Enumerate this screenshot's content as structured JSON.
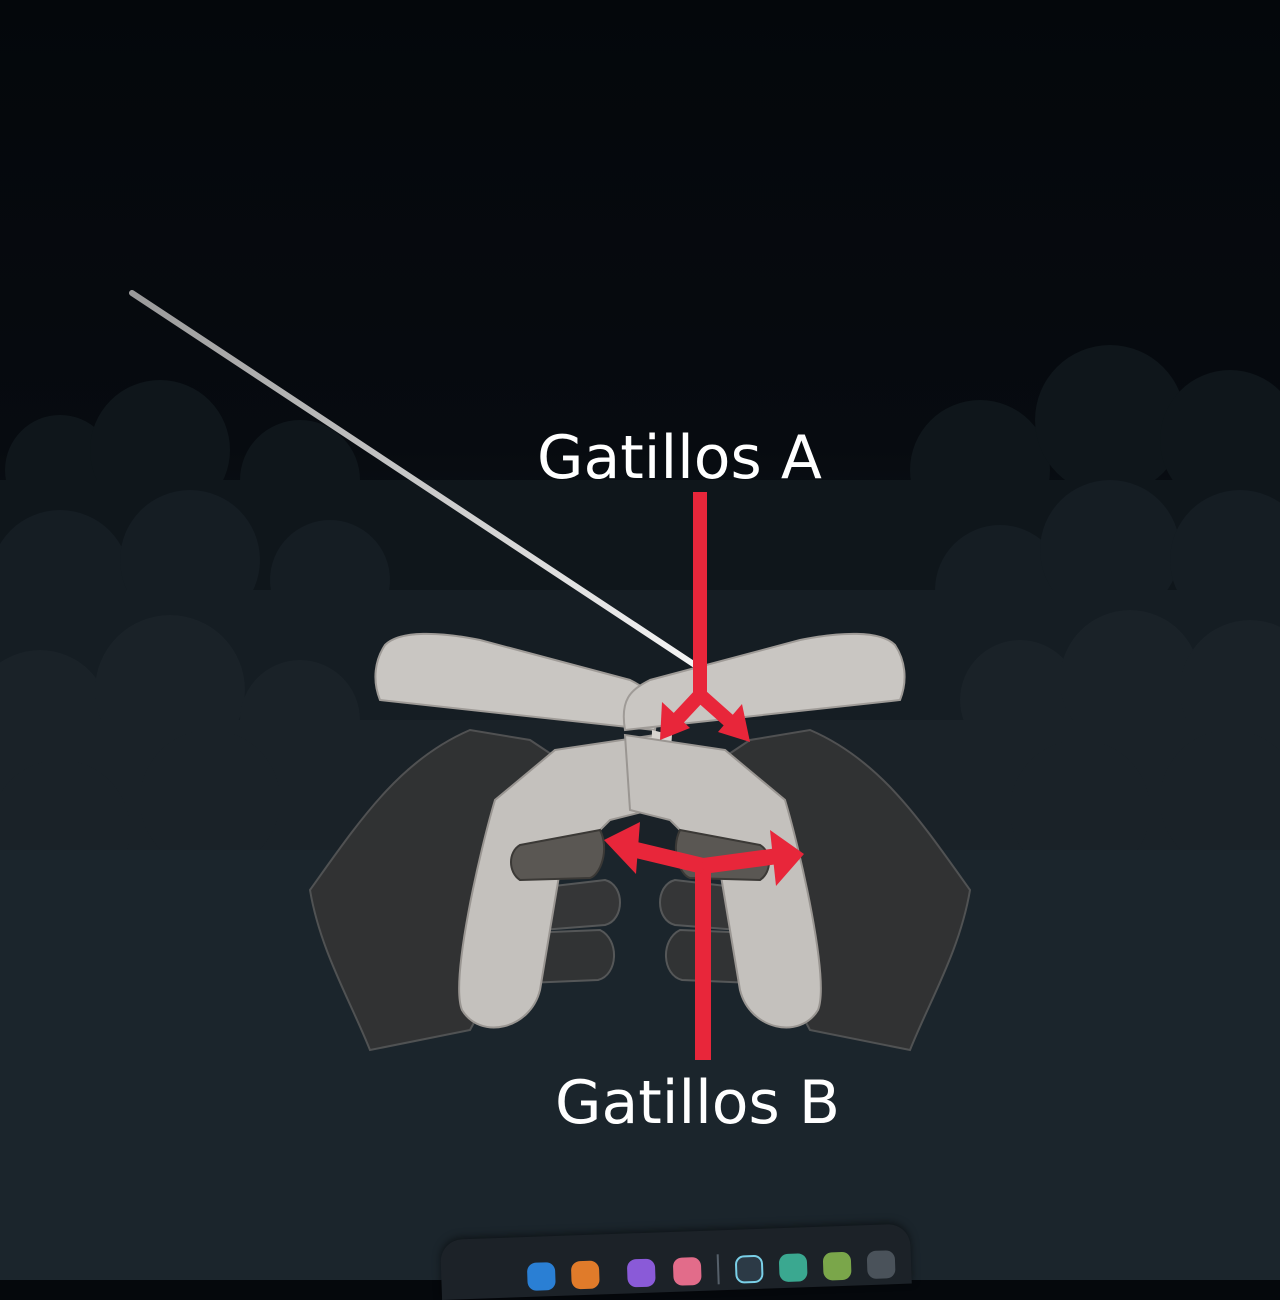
{
  "annotations": {
    "trigger_a_label": "Gatillos A",
    "trigger_b_label": "Gatillos B"
  },
  "colors": {
    "sky_top": "#05080c",
    "sky_bottom": "#1c252c",
    "cloud": "#1a2228",
    "controller": "#c9c6c2",
    "hand": "#3a3a3a",
    "arrow": "#e8263a",
    "laser": "#e8e8e8",
    "label": "#ffffff"
  },
  "taskbar": {
    "apps": [
      {
        "icon": "app-blue-icon",
        "color": "#2a7fd4"
      },
      {
        "icon": "app-orange-icon",
        "color": "#e07b2a"
      },
      {
        "icon": "app-purple-icon",
        "color": "#8a5ad8"
      },
      {
        "icon": "app-pink-icon",
        "color": "#e26c8a"
      },
      {
        "icon": "settings-icon",
        "color": "#2c3a46"
      },
      {
        "icon": "home-icon",
        "color": "#3aa890"
      },
      {
        "icon": "store-icon",
        "color": "#7aa64a"
      },
      {
        "icon": "app-grid-icon",
        "color": "#4a525a"
      }
    ]
  }
}
